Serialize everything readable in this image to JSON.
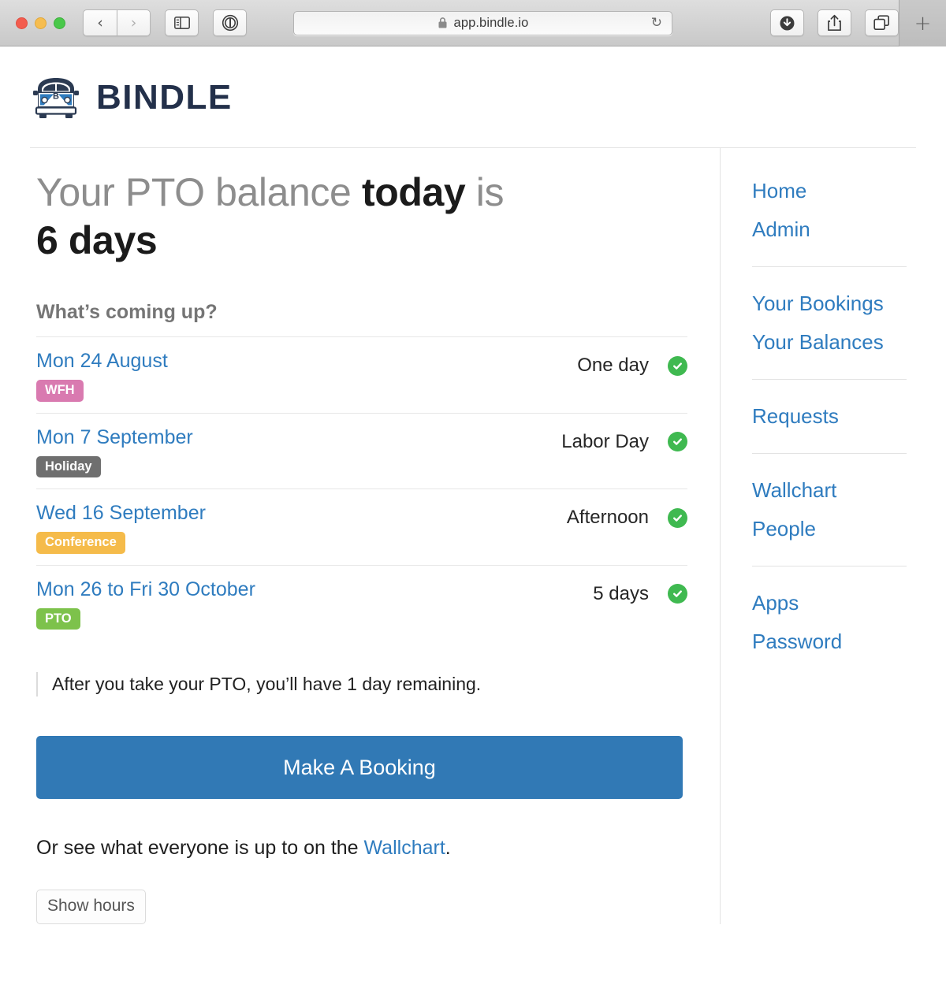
{
  "browser": {
    "url": "app.bindle.io",
    "lock_icon": "lock-icon",
    "reload_icon": "↻",
    "back_icon": "‹",
    "forward_icon": "›",
    "newtab_label": "+",
    "traffic_lights": [
      "close",
      "minimize",
      "zoom"
    ]
  },
  "header": {
    "logo_icon": "bindle-bus-logo",
    "brand": "BINDLE"
  },
  "main": {
    "headline": {
      "part1": "Your PTO balance ",
      "bold1": "today",
      "part2": " is",
      "bold2": "6 days"
    },
    "subhead": "What’s coming up?",
    "bookings": [
      {
        "date": "Mon 24 August",
        "badge": "WFH",
        "badge_color": "#d97ab0",
        "value": "One day",
        "status_icon": "check-circle-icon"
      },
      {
        "date": "Mon 7 September",
        "badge": "Holiday",
        "badge_color": "#6f6f6f",
        "value": "Labor Day",
        "status_icon": "check-circle-icon"
      },
      {
        "date": "Wed 16 September",
        "badge": "Conference",
        "badge_color": "#f5bb4a",
        "value": "Afternoon",
        "status_icon": "check-circle-icon"
      },
      {
        "date": "Mon 26 to Fri 30 October",
        "badge": "PTO",
        "badge_color": "#7dc24b",
        "value": "5 days",
        "status_icon": "check-circle-icon"
      }
    ],
    "note": "After you take your PTO, you’ll have 1 day remaining.",
    "cta_label": "Make A Booking",
    "tail_prefix": "Or see what everyone is up to on the ",
    "tail_link": "Wallchart",
    "tail_suffix": ".",
    "show_hours_label": "Show hours"
  },
  "sidebar": {
    "groups": [
      {
        "items": [
          {
            "label": "Home"
          },
          {
            "label": "Admin"
          }
        ]
      },
      {
        "items": [
          {
            "label": "Your Bookings"
          },
          {
            "label": "Your Balances"
          }
        ]
      },
      {
        "items": [
          {
            "label": "Requests"
          }
        ]
      },
      {
        "items": [
          {
            "label": "Wallchart"
          },
          {
            "label": "People"
          }
        ]
      },
      {
        "items": [
          {
            "label": "Apps"
          },
          {
            "label": "Password"
          }
        ]
      }
    ]
  },
  "colors": {
    "link": "#2f7cbf",
    "cta": "#3179b5",
    "brand_dark": "#23304a",
    "status_green": "#3fb950"
  }
}
